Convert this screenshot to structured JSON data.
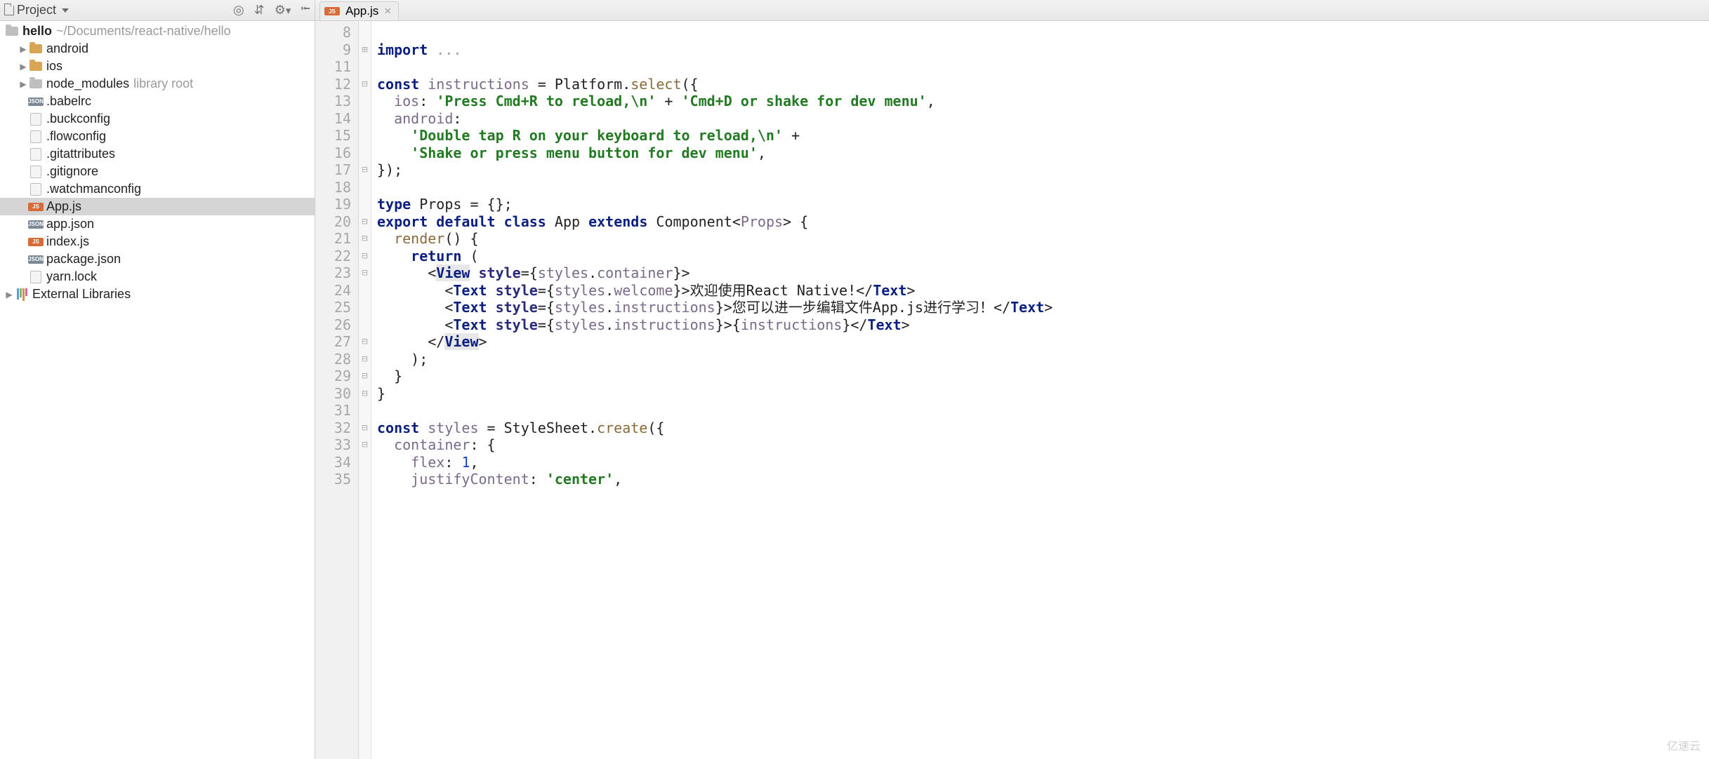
{
  "sidebar": {
    "title": "Project",
    "toolbar_icons": [
      "target-icon",
      "slider-icon",
      "gear-icon",
      "collapse-icon"
    ],
    "root": {
      "name": "hello",
      "path": "~/Documents/react-native/hello"
    },
    "items": [
      {
        "kind": "folder",
        "label": "android",
        "icon": "folder-orange",
        "expandable": true
      },
      {
        "kind": "folder",
        "label": "ios",
        "icon": "folder-orange",
        "expandable": true
      },
      {
        "kind": "folder",
        "label": "node_modules",
        "icon": "folder-grey",
        "hint": "library root",
        "expandable": true
      },
      {
        "kind": "file",
        "label": ".babelrc",
        "icon": "json"
      },
      {
        "kind": "file",
        "label": ".buckconfig",
        "icon": "file"
      },
      {
        "kind": "file",
        "label": ".flowconfig",
        "icon": "file"
      },
      {
        "kind": "file",
        "label": ".gitattributes",
        "icon": "file"
      },
      {
        "kind": "file",
        "label": ".gitignore",
        "icon": "file"
      },
      {
        "kind": "file",
        "label": ".watchmanconfig",
        "icon": "file"
      },
      {
        "kind": "file",
        "label": "App.js",
        "icon": "js",
        "selected": true
      },
      {
        "kind": "file",
        "label": "app.json",
        "icon": "json"
      },
      {
        "kind": "file",
        "label": "index.js",
        "icon": "js"
      },
      {
        "kind": "file",
        "label": "package.json",
        "icon": "json"
      },
      {
        "kind": "file",
        "label": "yarn.lock",
        "icon": "file"
      }
    ],
    "external_libs_label": "External Libraries"
  },
  "editor": {
    "tab": {
      "label": "App.js",
      "icon": "js"
    },
    "first_line_number": 8,
    "last_line_number": 35,
    "code_lines": [
      {
        "n": 8,
        "fold": "",
        "segs": []
      },
      {
        "n": 9,
        "fold": "+",
        "segs": [
          {
            "c": "kw",
            "t": "import"
          },
          {
            "c": "txt",
            "t": " "
          },
          {
            "c": "grey",
            "t": "..."
          }
        ]
      },
      {
        "n": 11,
        "fold": "",
        "segs": []
      },
      {
        "n": 12,
        "fold": "⊟",
        "segs": [
          {
            "c": "kw",
            "t": "const"
          },
          {
            "c": "txt",
            "t": " "
          },
          {
            "c": "ident",
            "t": "instructions"
          },
          {
            "c": "txt",
            "t": " = Platform."
          },
          {
            "c": "call",
            "t": "select"
          },
          {
            "c": "txt",
            "t": "({"
          }
        ]
      },
      {
        "n": 13,
        "fold": "",
        "segs": [
          {
            "c": "txt",
            "t": "  "
          },
          {
            "c": "prop",
            "t": "ios"
          },
          {
            "c": "txt",
            "t": ": "
          },
          {
            "c": "str",
            "t": "'Press Cmd+R to reload,\\n'"
          },
          {
            "c": "txt",
            "t": " + "
          },
          {
            "c": "str",
            "t": "'Cmd+D or shake for dev menu'"
          },
          {
            "c": "txt",
            "t": ","
          }
        ]
      },
      {
        "n": 14,
        "fold": "",
        "segs": [
          {
            "c": "txt",
            "t": "  "
          },
          {
            "c": "prop",
            "t": "android"
          },
          {
            "c": "txt",
            "t": ":"
          }
        ]
      },
      {
        "n": 15,
        "fold": "",
        "segs": [
          {
            "c": "txt",
            "t": "    "
          },
          {
            "c": "str",
            "t": "'Double tap R on your keyboard to reload,\\n'"
          },
          {
            "c": "txt",
            "t": " +"
          }
        ]
      },
      {
        "n": 16,
        "fold": "",
        "segs": [
          {
            "c": "txt",
            "t": "    "
          },
          {
            "c": "str",
            "t": "'Shake or press menu button for dev menu'"
          },
          {
            "c": "txt",
            "t": ","
          }
        ]
      },
      {
        "n": 17,
        "fold": "⊟",
        "segs": [
          {
            "c": "txt",
            "t": "});"
          }
        ]
      },
      {
        "n": 18,
        "fold": "",
        "segs": []
      },
      {
        "n": 19,
        "fold": "",
        "segs": [
          {
            "c": "kw",
            "t": "type"
          },
          {
            "c": "txt",
            "t": " Props = {};"
          }
        ]
      },
      {
        "n": 20,
        "fold": "⊟",
        "segs": [
          {
            "c": "kw",
            "t": "export"
          },
          {
            "c": "txt",
            "t": " "
          },
          {
            "c": "kw",
            "t": "default"
          },
          {
            "c": "txt",
            "t": " "
          },
          {
            "c": "kw",
            "t": "class"
          },
          {
            "c": "txt",
            "t": " App "
          },
          {
            "c": "kw",
            "t": "extends"
          },
          {
            "c": "txt",
            "t": " Component<"
          },
          {
            "c": "ident",
            "t": "Props"
          },
          {
            "c": "txt",
            "t": "> {"
          }
        ]
      },
      {
        "n": 21,
        "fold": "⊟",
        "segs": [
          {
            "c": "txt",
            "t": "  "
          },
          {
            "c": "call",
            "t": "render"
          },
          {
            "c": "txt",
            "t": "() {"
          }
        ]
      },
      {
        "n": 22,
        "fold": "⊟",
        "segs": [
          {
            "c": "txt",
            "t": "    "
          },
          {
            "c": "kw",
            "t": "return"
          },
          {
            "c": "txt",
            "t": " ("
          }
        ]
      },
      {
        "n": 23,
        "fold": "⊟",
        "segs": [
          {
            "c": "txt",
            "t": "      "
          },
          {
            "c": "txt",
            "t": "<"
          },
          {
            "c": "tag tagb",
            "t": "View"
          },
          {
            "c": "txt",
            "t": " "
          },
          {
            "c": "attr",
            "t": "style"
          },
          {
            "c": "txt",
            "t": "={"
          },
          {
            "c": "ident",
            "t": "styles"
          },
          {
            "c": "txt",
            "t": "."
          },
          {
            "c": "prop",
            "t": "container"
          },
          {
            "c": "txt",
            "t": "}>"
          }
        ]
      },
      {
        "n": 24,
        "fold": "",
        "segs": [
          {
            "c": "txt",
            "t": "        <"
          },
          {
            "c": "tag",
            "t": "Text"
          },
          {
            "c": "txt",
            "t": " "
          },
          {
            "c": "attr",
            "t": "style"
          },
          {
            "c": "txt",
            "t": "={"
          },
          {
            "c": "ident",
            "t": "styles"
          },
          {
            "c": "txt",
            "t": "."
          },
          {
            "c": "prop",
            "t": "welcome"
          },
          {
            "c": "txt",
            "t": "}>欢迎使用React Native!</"
          },
          {
            "c": "tag",
            "t": "Text"
          },
          {
            "c": "txt",
            "t": ">"
          }
        ]
      },
      {
        "n": 25,
        "fold": "",
        "segs": [
          {
            "c": "txt",
            "t": "        <"
          },
          {
            "c": "tag",
            "t": "Text"
          },
          {
            "c": "txt",
            "t": " "
          },
          {
            "c": "attr",
            "t": "style"
          },
          {
            "c": "txt",
            "t": "={"
          },
          {
            "c": "ident",
            "t": "styles"
          },
          {
            "c": "txt",
            "t": "."
          },
          {
            "c": "prop",
            "t": "instructions"
          },
          {
            "c": "txt",
            "t": "}>您可以进一步编辑文件App.js进行学习！</"
          },
          {
            "c": "tag",
            "t": "Text"
          },
          {
            "c": "txt",
            "t": ">"
          }
        ]
      },
      {
        "n": 26,
        "fold": "",
        "segs": [
          {
            "c": "txt",
            "t": "        <"
          },
          {
            "c": "tag",
            "t": "Text"
          },
          {
            "c": "txt",
            "t": " "
          },
          {
            "c": "attr",
            "t": "style"
          },
          {
            "c": "txt",
            "t": "={"
          },
          {
            "c": "ident",
            "t": "styles"
          },
          {
            "c": "txt",
            "t": "."
          },
          {
            "c": "prop",
            "t": "instructions"
          },
          {
            "c": "txt",
            "t": "}>{"
          },
          {
            "c": "inst",
            "t": "instructions"
          },
          {
            "c": "txt",
            "t": "}</"
          },
          {
            "c": "tag",
            "t": "Text"
          },
          {
            "c": "txt",
            "t": ">"
          }
        ]
      },
      {
        "n": 27,
        "fold": "⊟",
        "segs": [
          {
            "c": "txt",
            "t": "      </"
          },
          {
            "c": "tag tagb",
            "t": "View"
          },
          {
            "c": "txt",
            "t": ">"
          }
        ]
      },
      {
        "n": 28,
        "fold": "⊟",
        "segs": [
          {
            "c": "txt",
            "t": "    );"
          }
        ]
      },
      {
        "n": 29,
        "fold": "⊟",
        "segs": [
          {
            "c": "txt",
            "t": "  }"
          }
        ]
      },
      {
        "n": 30,
        "fold": "⊟",
        "segs": [
          {
            "c": "txt",
            "t": "}"
          }
        ]
      },
      {
        "n": 31,
        "fold": "",
        "segs": []
      },
      {
        "n": 32,
        "fold": "⊟",
        "segs": [
          {
            "c": "kw",
            "t": "const"
          },
          {
            "c": "txt",
            "t": " "
          },
          {
            "c": "ident",
            "t": "styles"
          },
          {
            "c": "txt",
            "t": " = StyleSheet."
          },
          {
            "c": "call",
            "t": "create"
          },
          {
            "c": "txt",
            "t": "({"
          }
        ]
      },
      {
        "n": 33,
        "fold": "⊟",
        "segs": [
          {
            "c": "txt",
            "t": "  "
          },
          {
            "c": "prop",
            "t": "container"
          },
          {
            "c": "txt",
            "t": ": {"
          }
        ]
      },
      {
        "n": 34,
        "fold": "",
        "segs": [
          {
            "c": "txt",
            "t": "    "
          },
          {
            "c": "prop",
            "t": "flex"
          },
          {
            "c": "txt",
            "t": ": "
          },
          {
            "c": "num",
            "t": "1"
          },
          {
            "c": "txt",
            "t": ","
          }
        ]
      },
      {
        "n": 35,
        "fold": "",
        "segs": [
          {
            "c": "txt",
            "t": "    "
          },
          {
            "c": "prop",
            "t": "justifyContent"
          },
          {
            "c": "txt",
            "t": ": "
          },
          {
            "c": "str",
            "t": "'center'"
          },
          {
            "c": "txt",
            "t": ","
          }
        ]
      }
    ]
  },
  "watermark": "亿速云"
}
